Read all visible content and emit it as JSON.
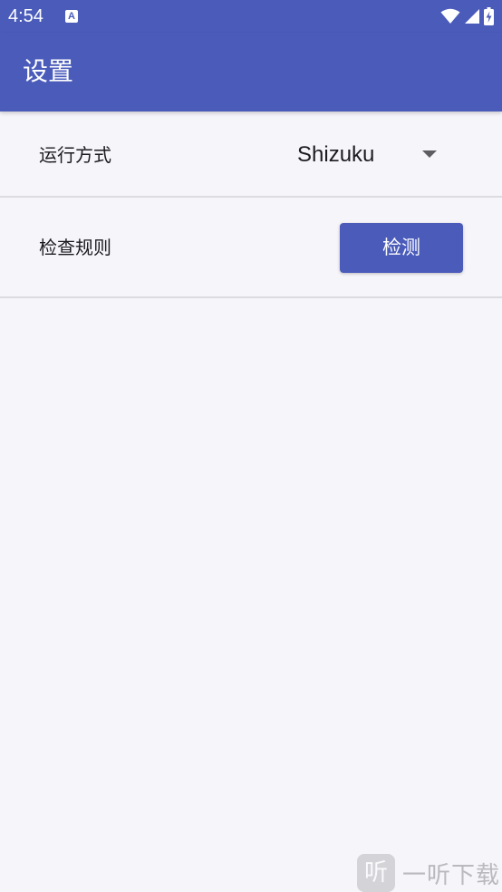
{
  "status_bar": {
    "time": "4:54",
    "notification_icon": "A",
    "icons": [
      "wifi-icon",
      "signal-icon",
      "battery-charging-icon"
    ]
  },
  "app_bar": {
    "title": "设置"
  },
  "settings": {
    "run_mode": {
      "label": "运行方式",
      "selected_value": "Shizuku"
    },
    "check_rules": {
      "label": "检查规则",
      "button_label": "检测"
    }
  },
  "watermark": {
    "logo_char": "听",
    "text": "一听下载"
  },
  "colors": {
    "primary": "#4a5bba",
    "background": "#f6f5fa",
    "divider": "#dcdbe0"
  }
}
